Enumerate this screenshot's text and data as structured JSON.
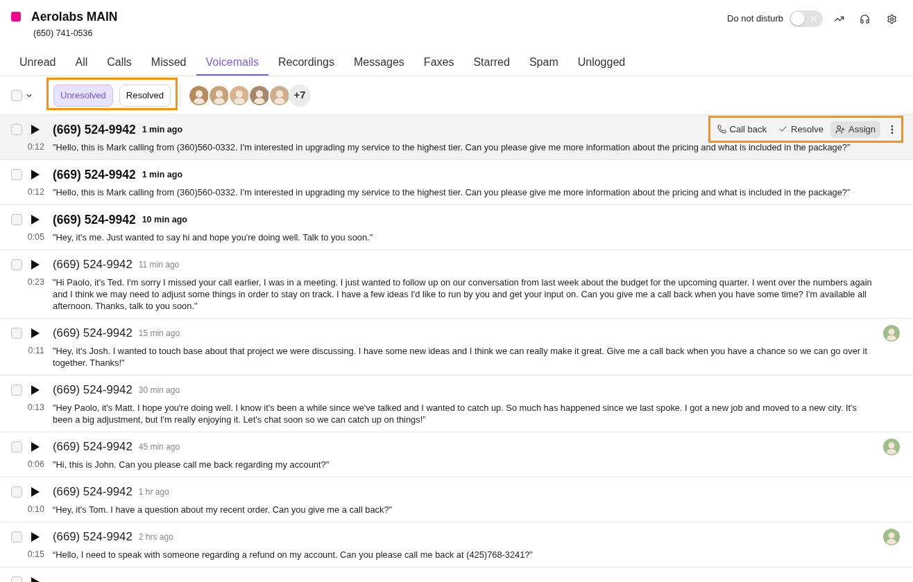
{
  "header": {
    "title": "Aerolabs MAIN",
    "phone": "(650) 741-0536",
    "dnd": {
      "label": "Do not disturb",
      "on": false
    }
  },
  "tabs": [
    {
      "label": "Unread",
      "selected": false
    },
    {
      "label": "All",
      "selected": false
    },
    {
      "label": "Calls",
      "selected": false
    },
    {
      "label": "Missed",
      "selected": false
    },
    {
      "label": "Voicemails",
      "selected": true
    },
    {
      "label": "Recordings",
      "selected": false
    },
    {
      "label": "Messages",
      "selected": false
    },
    {
      "label": "Faxes",
      "selected": false
    },
    {
      "label": "Starred",
      "selected": false
    },
    {
      "label": "Spam",
      "selected": false
    },
    {
      "label": "Unlogged",
      "selected": false
    }
  ],
  "filter_bar": {
    "select_all_checked": false,
    "highlighted": true,
    "filters": [
      {
        "label": "Unresolved",
        "selected": true
      },
      {
        "label": "Resolved",
        "selected": false
      }
    ],
    "agent_avatars": [
      {
        "kind": "photo"
      },
      {
        "kind": "photo"
      },
      {
        "kind": "photo"
      },
      {
        "kind": "photo"
      },
      {
        "kind": "photo"
      }
    ],
    "more_agents": "+7"
  },
  "rows": [
    {
      "checked": false,
      "unread": true,
      "highlighted": true,
      "phone": "(669) 524-9942",
      "time": "1 min ago",
      "duration": "0:12",
      "transcript": "\"Hello, this is Mark calling from (360)560-0332. I'm interested in upgrading my service to the highest tier. Can you please give me more information about the pricing and what is included in the package?”",
      "actions": {
        "highlighted": true,
        "items": [
          {
            "kind": "call",
            "label": "Call back",
            "hovered": false
          },
          {
            "kind": "resolve",
            "label": "Resolve",
            "hovered": false
          },
          {
            "kind": "assign",
            "label": "Assign",
            "hovered": true
          },
          {
            "kind": "more",
            "hovered": false
          }
        ]
      }
    },
    {
      "checked": false,
      "unread": true,
      "highlighted": false,
      "phone": "(669) 524-9942",
      "time": "1 min ago",
      "duration": "0:12",
      "transcript": "\"Hello, this is Mark calling from (360)560-0332. I'm interested in upgrading my service to the highest tier. Can you please give me more information about the pricing and what is included in the package?”"
    },
    {
      "checked": false,
      "unread": true,
      "highlighted": false,
      "phone": "(669) 524-9942",
      "time": "10 min ago",
      "duration": "0:05",
      "transcript": "\"Hey, it's me. Just wanted to say hi and hope you're doing well. Talk to you soon.\""
    },
    {
      "checked": false,
      "unread": false,
      "highlighted": false,
      "phone": "(669) 524-9942",
      "time": "11 min ago",
      "duration": "0:23",
      "transcript": "\"Hi Paolo, it's Ted. I'm sorry I missed your call earlier, I was in a meeting. I just wanted to follow up on our conversation from last week about the budget for the upcoming quarter. I went over the numbers again and I think we may need to adjust some things in order to stay on track. I have a few ideas I'd like to run by you and get your input on. Can you give me a call back when you have some time? I'm available all afternoon. Thanks, talk to you soon.\""
    },
    {
      "checked": false,
      "unread": false,
      "highlighted": false,
      "assignee": {
        "kind": "photo"
      },
      "phone": "(669) 524-9942",
      "time": "15 min ago",
      "duration": "0:11",
      "transcript": "\"Hey, it's Josh. I wanted to touch base about that project we were discussing. I have some new ideas and I think we can really make it great. Give me a call back when you have a chance so we can go over it together. Thanks!\""
    },
    {
      "checked": false,
      "unread": false,
      "highlighted": false,
      "phone": "(669) 524-9942",
      "time": "30 min ago",
      "duration": "0:13",
      "transcript": "\"Hey Paolo, it's Matt. I hope you're doing well. I know it's been a while since we've talked and I wanted to catch up. So much has happened since we last spoke. I got a new job and moved to a new city. It's been a big adjustment, but I'm really enjoying it. Let's chat soon so we can catch up on things!”"
    },
    {
      "checked": false,
      "unread": false,
      "highlighted": false,
      "assignee": {
        "kind": "photo"
      },
      "phone": "(669) 524-9942",
      "time": "45 min ago",
      "duration": "0:06",
      "transcript": "\"Hi, this is John. Can you please call me back regarding my account?\""
    },
    {
      "checked": false,
      "unread": false,
      "highlighted": false,
      "phone": "(669) 524-9942",
      "time": "1 hr ago",
      "duration": "0:10",
      "transcript": "“Hey, it's Tom. I have a question about my recent order. Can you give me a call back?\""
    },
    {
      "checked": false,
      "unread": false,
      "highlighted": false,
      "assignee": {
        "kind": "photo"
      },
      "phone": "(669) 524-9942",
      "time": "2 hrs ago",
      "duration": "0:15",
      "transcript": "“Hello, I need to speak with someone regarding a refund on my account. Can you please call me back at (425)768-3241?”"
    },
    {
      "checked": false,
      "highlighted": false
    }
  ]
}
